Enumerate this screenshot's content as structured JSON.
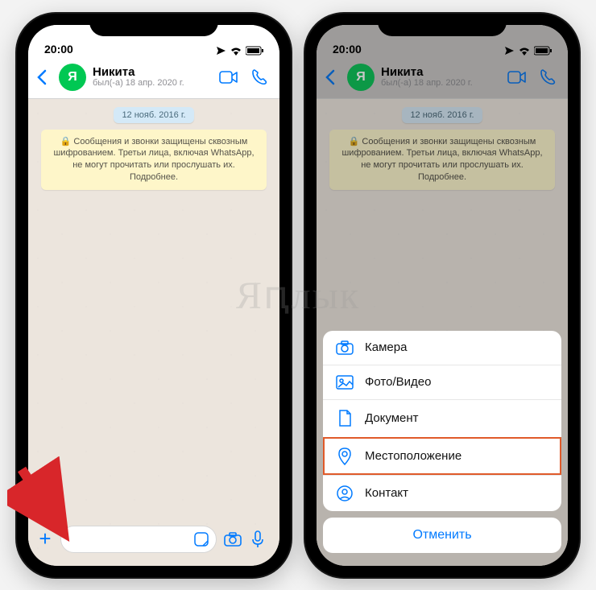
{
  "status": {
    "time": "20:00"
  },
  "contact": {
    "name": "Никита",
    "status": "был(-а) 18 апр. 2020 г.",
    "avatar_letter": "Я"
  },
  "chat": {
    "date": "12 нояб. 2016 г.",
    "encryption_notice": "🔒 Сообщения и звонки защищены сквозным шифрованием. Третьи лица, включая WhatsApp, не могут прочитать или прослушать их. Подробнее."
  },
  "attach_menu": {
    "items": [
      {
        "label": "Камера",
        "icon": "camera"
      },
      {
        "label": "Фото/Видео",
        "icon": "image"
      },
      {
        "label": "Документ",
        "icon": "document"
      },
      {
        "label": "Местоположение",
        "icon": "pin",
        "highlight": true
      },
      {
        "label": "Контакт",
        "icon": "person"
      }
    ],
    "cancel": "Отменить"
  },
  "watermark": "Яԥлык",
  "colors": {
    "accent": "#007aff",
    "highlight": "#e05a2a"
  }
}
